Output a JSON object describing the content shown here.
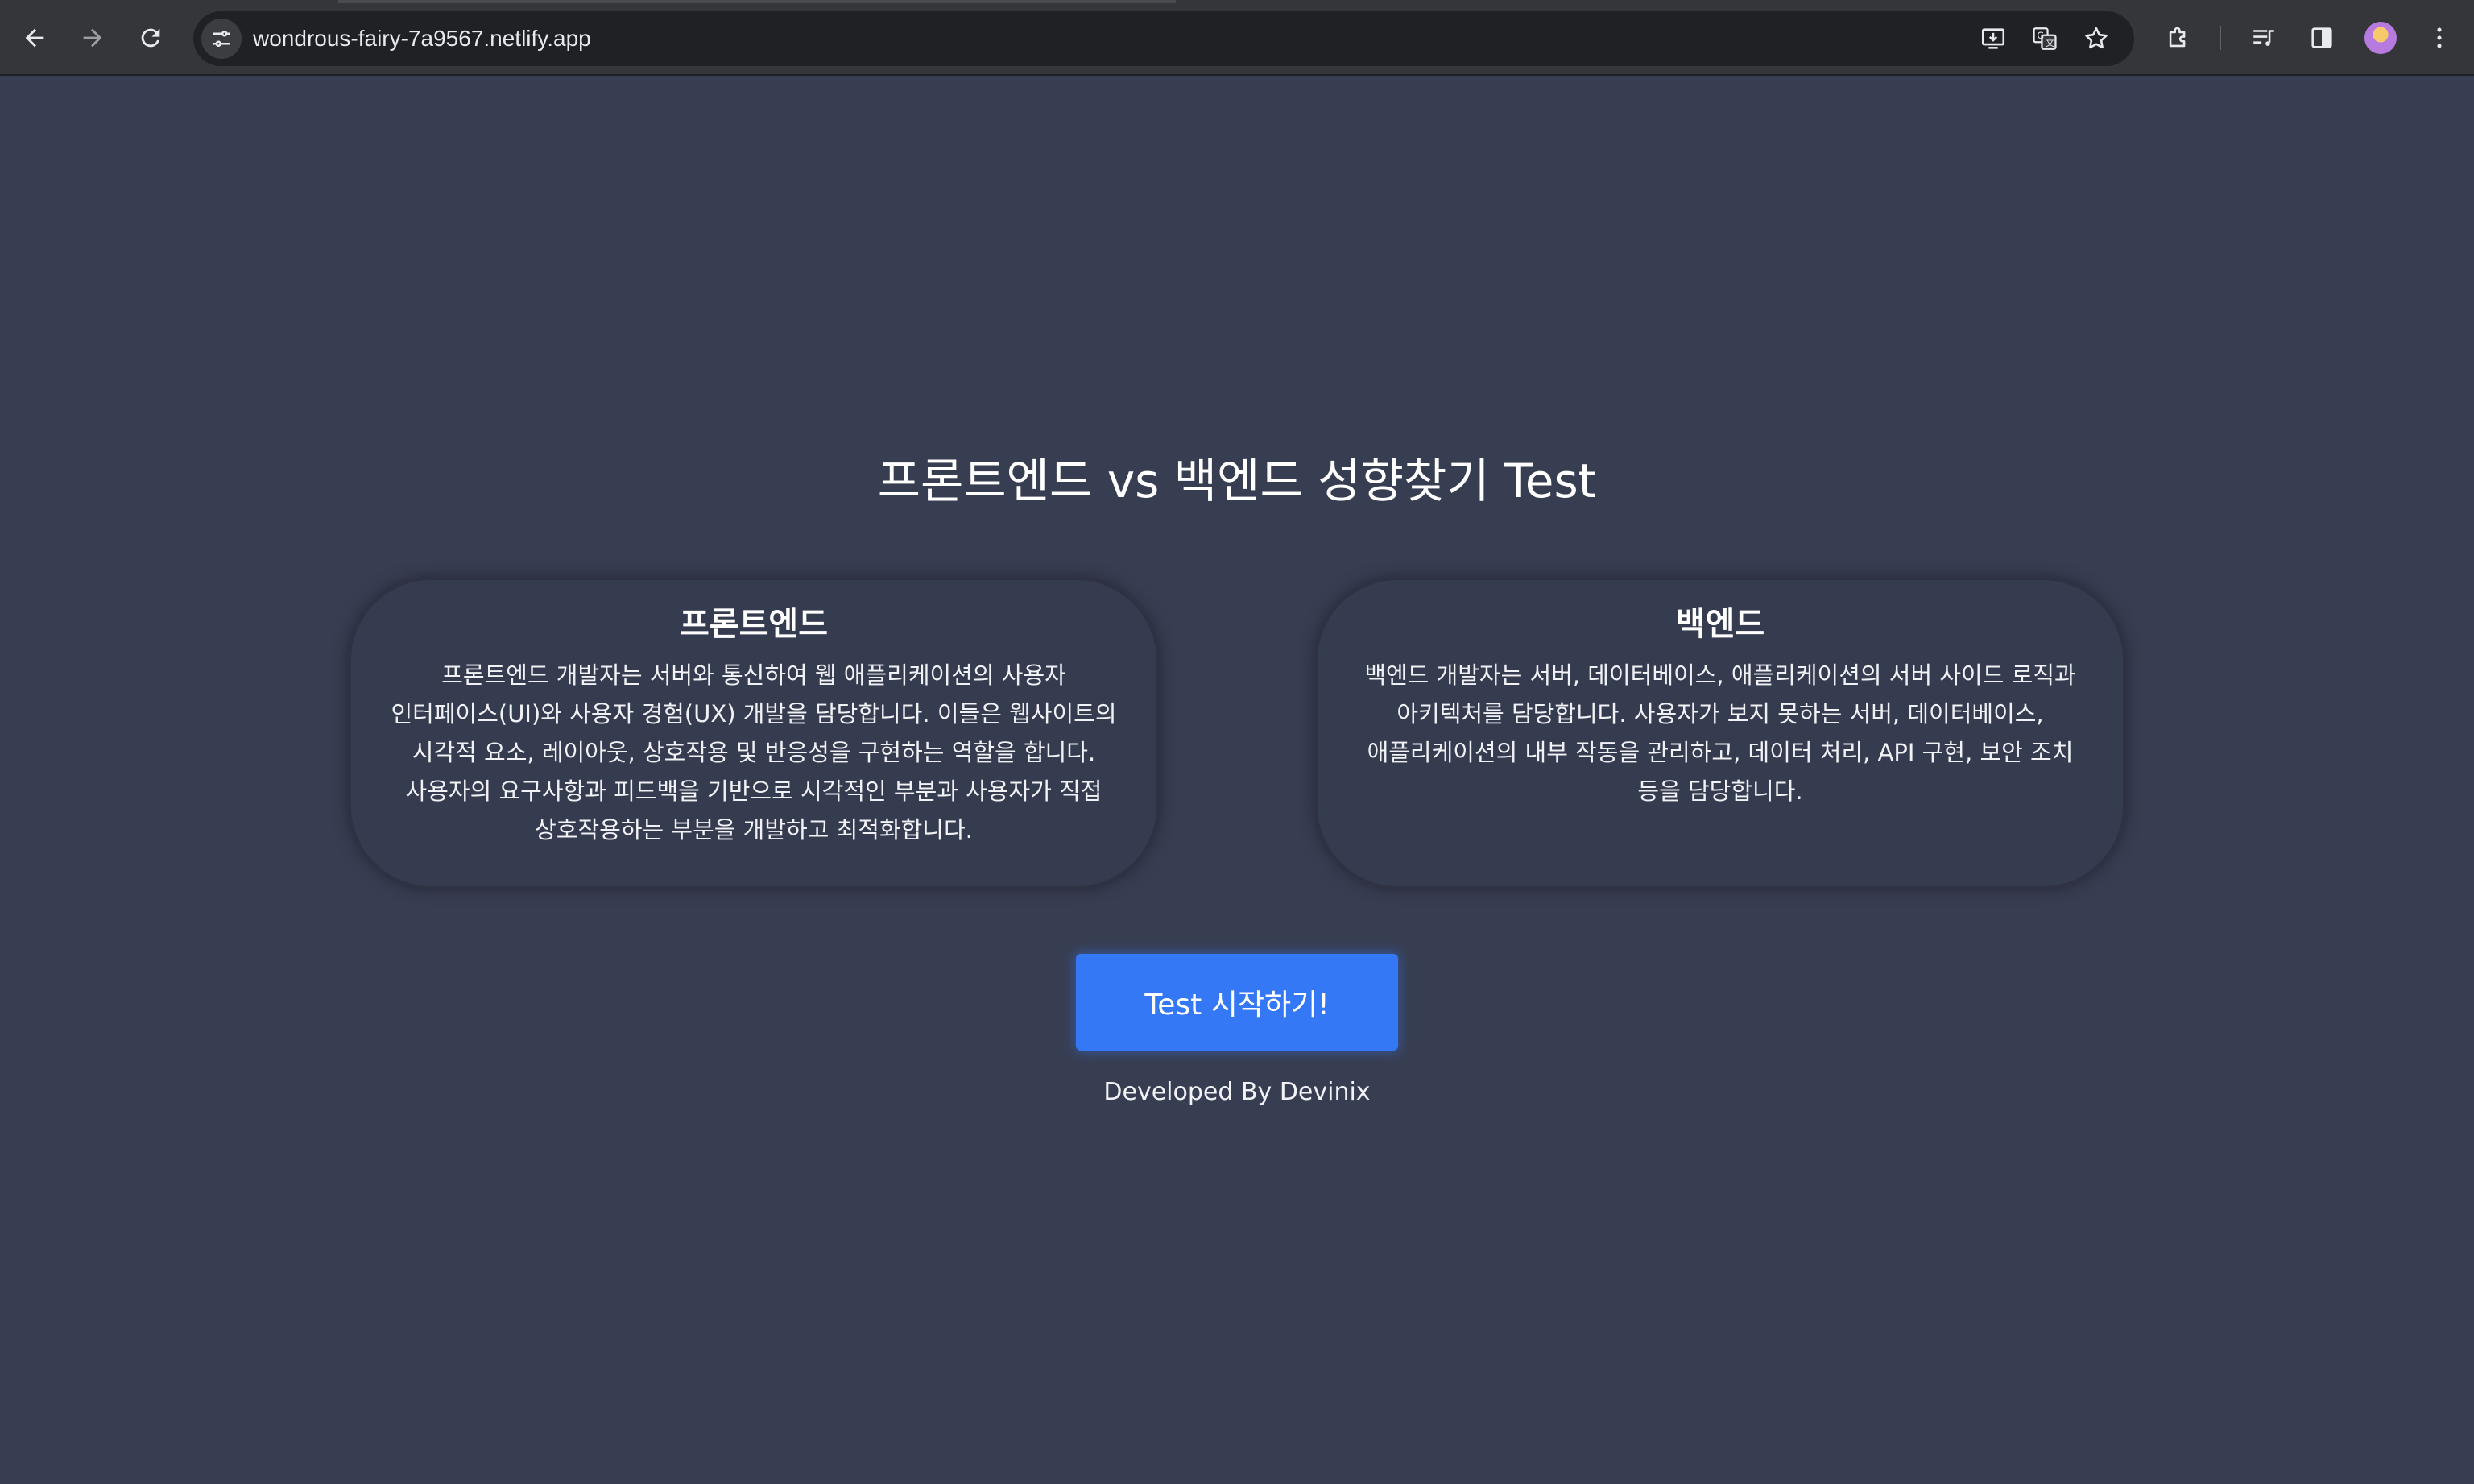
{
  "browser": {
    "url": "wondrous-fairy-7a9567.netlify.app",
    "icons": {
      "back": "arrow-left-icon",
      "forward": "arrow-right-icon",
      "reload": "reload-icon",
      "site_info": "tune-icon",
      "install": "install-app-icon",
      "translate": "translate-icon",
      "bookmark": "star-icon",
      "extensions": "puzzle-icon",
      "media": "media-queue-icon",
      "side_panel": "side-panel-icon",
      "menu": "kebab-menu-icon"
    }
  },
  "page": {
    "title": "프론트엔드 vs 백엔드 성향찾기 Test",
    "cards": [
      {
        "heading": "프론트엔드",
        "lines": [
          "프론트엔드 개발자는 서버와 통신하여 웹 애플리케이션의 사용자",
          "인터페이스(UI)와 사용자 경험(UX) 개발을 담당합니다. 이들은 웹사이트의",
          "시각적 요소, 레이아웃, 상호작용 및 반응성을 구현하는 역할을 합니다.",
          "사용자의 요구사항과 피드백을 기반으로 시각적인 부분과 사용자가 직접",
          "상호작용하는 부분을 개발하고 최적화합니다."
        ]
      },
      {
        "heading": "백엔드",
        "lines": [
          "백엔드 개발자는 서버, 데이터베이스, 애플리케이션의 서버 사이드 로직과",
          "아키텍처를 담당합니다. 사용자가 보지 못하는 서버, 데이터베이스,",
          "애플리케이션의 내부 작동을 관리하고, 데이터 처리, API 구현, 보안 조치",
          "등을 담당합니다."
        ]
      }
    ],
    "start_button": "Test 시작하기!",
    "footer": "Developed By Devinix"
  },
  "colors": {
    "background": "#383e52",
    "card": "#363c4f",
    "button": "#3478f6",
    "text": "#ffffff"
  }
}
